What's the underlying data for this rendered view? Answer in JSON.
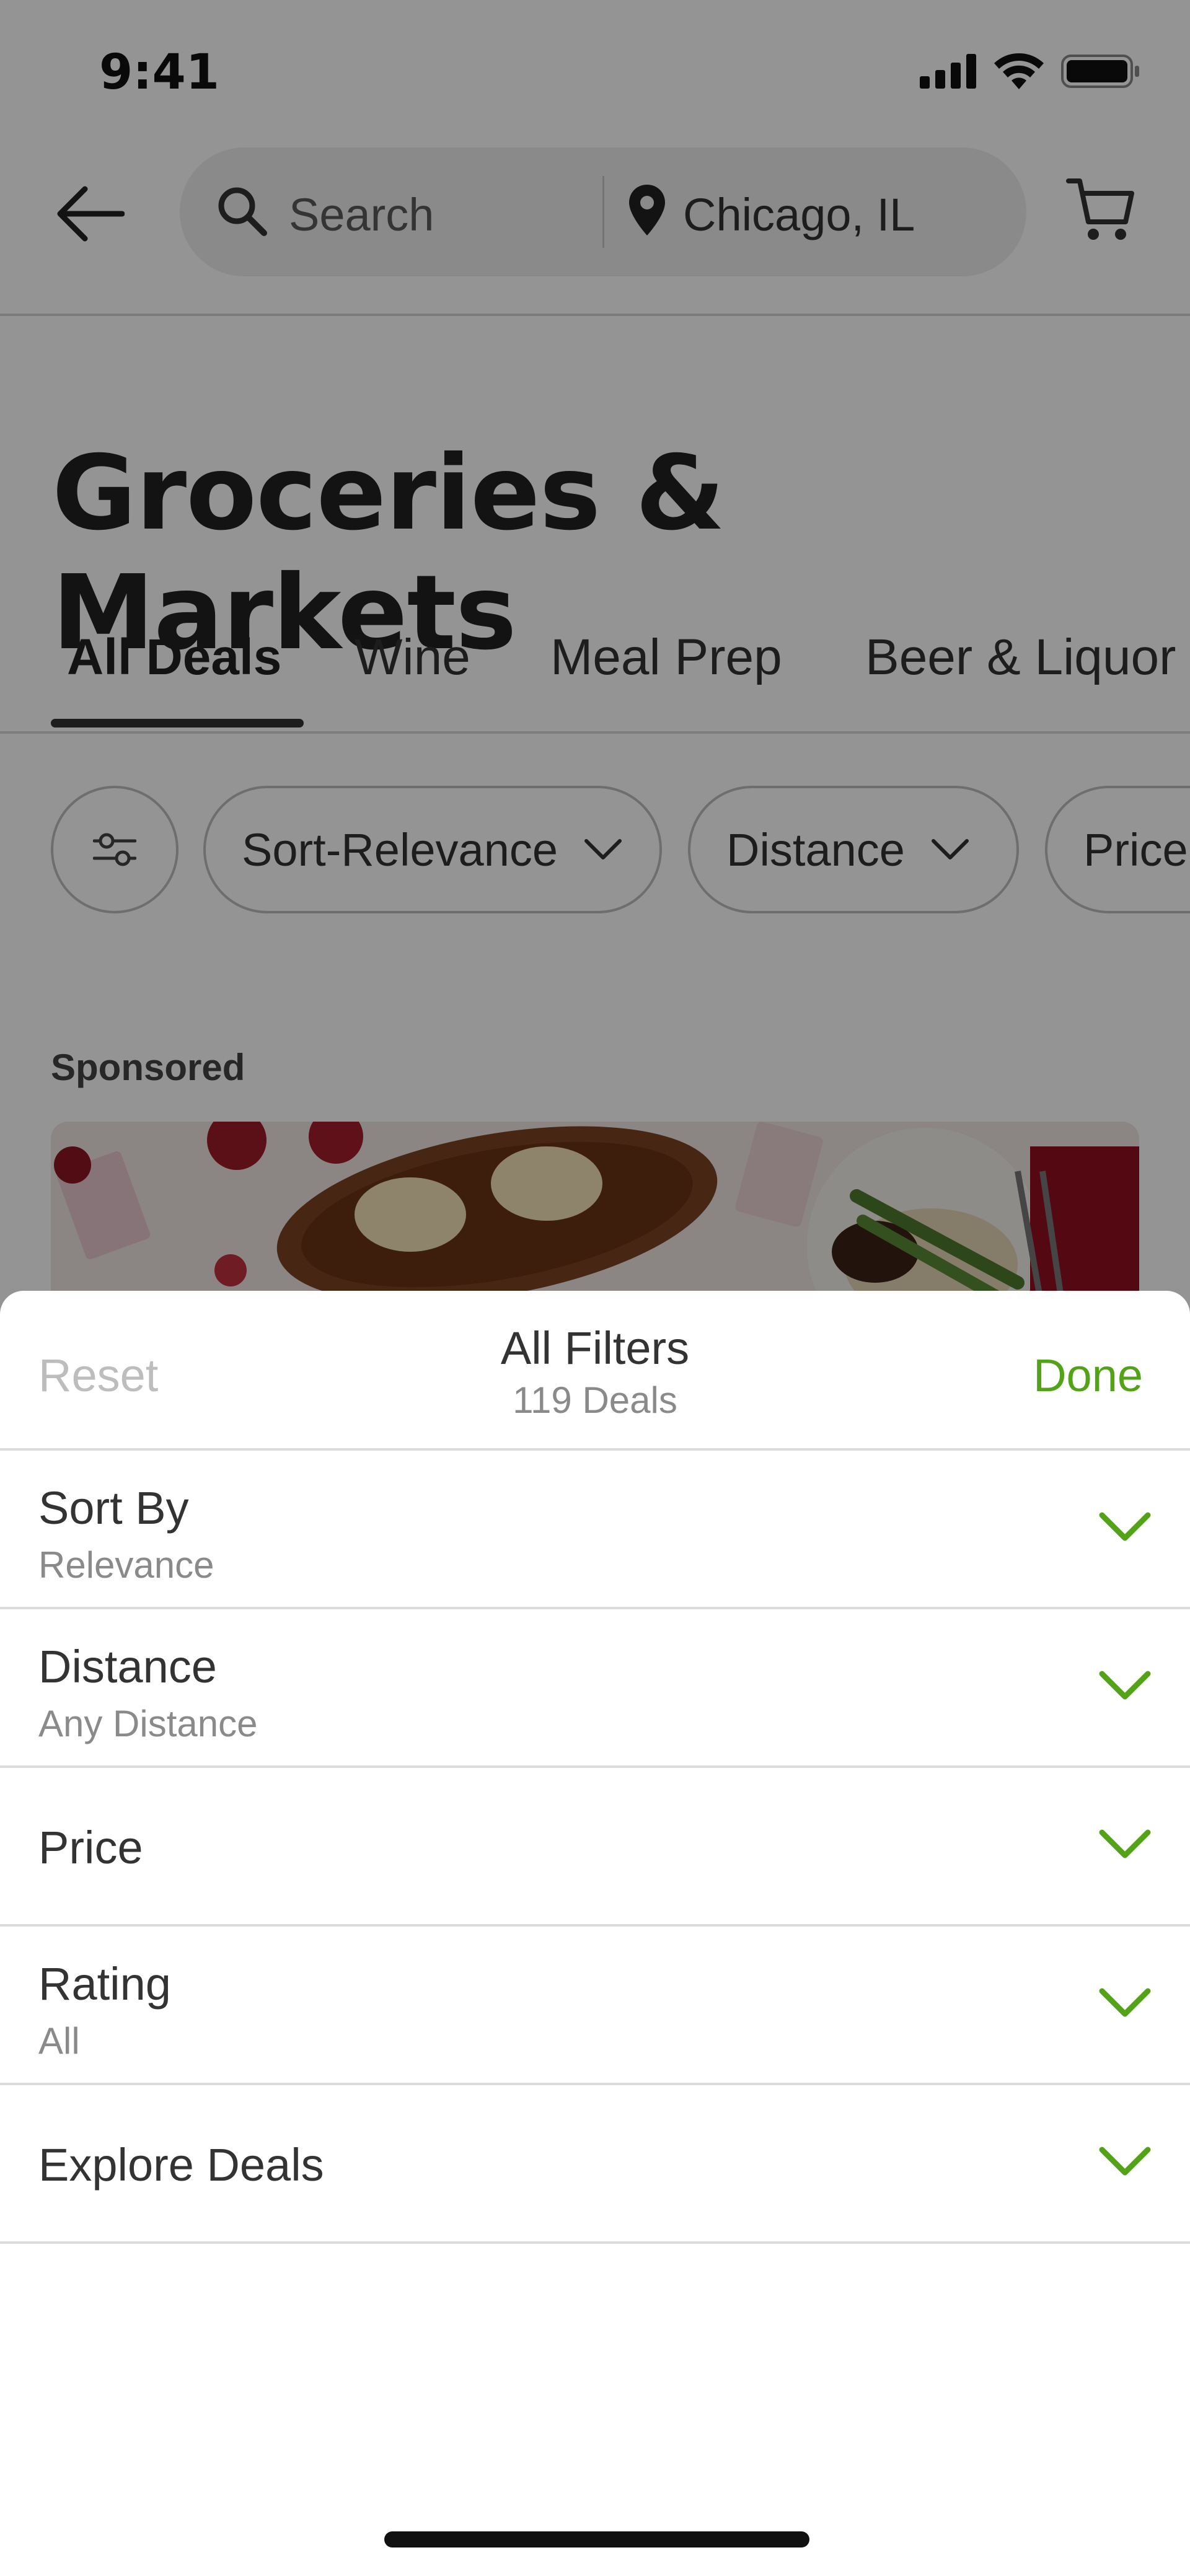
{
  "status_bar": {
    "time": "9:41"
  },
  "header": {
    "search_placeholder": "Search",
    "location": "Chicago, IL"
  },
  "page": {
    "title": "Groceries & Markets"
  },
  "tabs": [
    {
      "label": "All Deals",
      "active": true
    },
    {
      "label": "Wine"
    },
    {
      "label": "Meal Prep"
    },
    {
      "label": "Beer & Liquor"
    }
  ],
  "chips": [
    {
      "label": "Sort-Relevance"
    },
    {
      "label": "Distance"
    },
    {
      "label": "Price"
    }
  ],
  "sponsored_label": "Sponsored",
  "filters_sheet": {
    "reset_label": "Reset",
    "title": "All Filters",
    "subtitle": "119 Deals",
    "done_label": "Done",
    "rows": [
      {
        "label": "Sort By",
        "value": "Relevance"
      },
      {
        "label": "Distance",
        "value": "Any Distance"
      },
      {
        "label": "Price",
        "value": ""
      },
      {
        "label": "Rating",
        "value": "All"
      },
      {
        "label": "Explore Deals",
        "value": ""
      }
    ]
  },
  "colors": {
    "accent_green": "#53a318",
    "overlay": "rgba(0,0,0,0.42)",
    "divider": "#dcdcdc"
  },
  "icons": [
    "back-arrow-icon",
    "search-icon",
    "location-pin-icon",
    "cart-icon",
    "filter-sliders-icon",
    "chevron-down-icon",
    "signal-icon",
    "wifi-icon",
    "battery-icon"
  ]
}
